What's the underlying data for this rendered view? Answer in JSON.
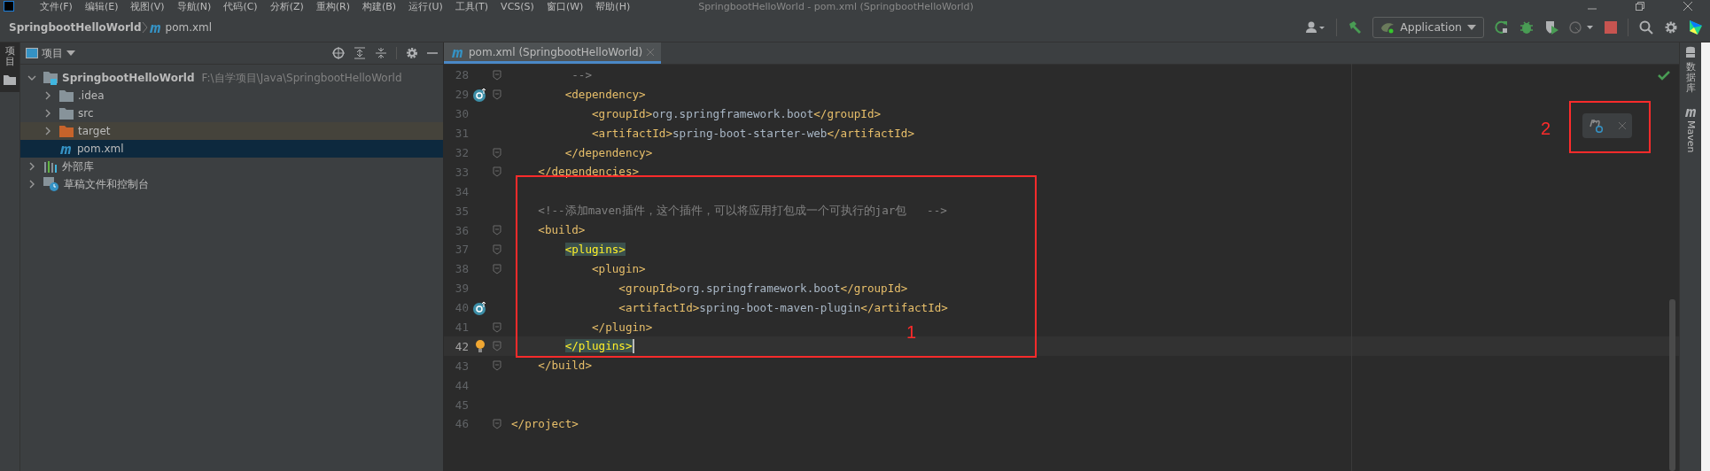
{
  "menu_bar": {
    "items": [
      "文件(F)",
      "编辑(E)",
      "视图(V)",
      "导航(N)",
      "代码(C)",
      "分析(Z)",
      "重构(R)",
      "构建(B)",
      "运行(U)",
      "工具(T)",
      "VCS(S)",
      "窗口(W)",
      "帮助(H)"
    ],
    "window_title": "SpringbootHelloWorld - pom.xml (SpringbootHelloWorld)"
  },
  "breadcrumb": [
    "SpringbootHelloWorld",
    "pom.xml"
  ],
  "toolbar": {
    "run_configuration": "Application"
  },
  "left_stripe": {
    "label": "项目"
  },
  "right_stripe": [
    "数据库",
    "Maven"
  ],
  "project_panel": {
    "title": "项目",
    "tree": [
      {
        "label": "SpringbootHelloWorld",
        "path": "F:\\自学项目\\Java\\SpringbootHelloWorld",
        "kind": "module",
        "expanded": true,
        "selected": false,
        "children": [
          {
            "label": ".idea",
            "kind": "folder",
            "expanded": false,
            "selected": false
          },
          {
            "label": "src",
            "kind": "folder",
            "expanded": false,
            "selected": false
          },
          {
            "label": "target",
            "kind": "excluded",
            "expanded": false,
            "selected": false
          },
          {
            "label": "pom.xml",
            "kind": "maven",
            "selected": true
          }
        ]
      },
      {
        "label": "外部库",
        "kind": "libraries",
        "expanded": false,
        "selected": false
      },
      {
        "label": "草稿文件和控制台",
        "kind": "scratches",
        "expanded": false,
        "selected": false
      }
    ]
  },
  "editor": {
    "tabs": [
      {
        "label": "pom.xml (SpringbootHelloWorld)",
        "selected": true
      }
    ],
    "lines": [
      {
        "number": "28",
        "text": "         -->",
        "kind": "comment",
        "fold": true,
        "override_marker": false,
        "bulb": false,
        "current": false,
        "match_highlight": false
      },
      {
        "number": "29",
        "text": "        <dependency>",
        "kind": "code",
        "fold": true,
        "override_marker": true,
        "bulb": false,
        "current": false,
        "match_highlight": false
      },
      {
        "number": "30",
        "text": "            <groupId>org.springframework.boot</groupId>",
        "kind": "code",
        "fold": false,
        "override_marker": false,
        "bulb": false,
        "current": false,
        "match_highlight": false
      },
      {
        "number": "31",
        "text": "            <artifactId>spring-boot-starter-web</artifactId>",
        "kind": "code",
        "fold": false,
        "override_marker": false,
        "bulb": false,
        "current": false,
        "match_highlight": false
      },
      {
        "number": "32",
        "text": "        </dependency>",
        "kind": "code",
        "fold": true,
        "override_marker": false,
        "bulb": false,
        "current": false,
        "match_highlight": false
      },
      {
        "number": "33",
        "text": "    </dependencies>",
        "kind": "code",
        "fold": true,
        "override_marker": false,
        "bulb": false,
        "current": false,
        "match_highlight": false
      },
      {
        "number": "34",
        "fold": false,
        "override_marker": false,
        "bulb": false,
        "current": false
      },
      {
        "number": "35",
        "text": "    <!--添加maven插件，这个插件，可以将应用打包成一个可执行的jar包   -->",
        "kind": "comment",
        "fold": false,
        "override_marker": false,
        "bulb": false,
        "current": false,
        "match_highlight": false
      },
      {
        "number": "36",
        "text": "    <build>",
        "kind": "code",
        "fold": true,
        "override_marker": false,
        "bulb": false,
        "current": false,
        "match_highlight": false
      },
      {
        "number": "37",
        "text": "        <plugins>",
        "kind": "code",
        "fold": true,
        "override_marker": false,
        "bulb": false,
        "current": false,
        "match_highlight": true
      },
      {
        "number": "38",
        "text": "            <plugin>",
        "kind": "code",
        "fold": true,
        "override_marker": false,
        "bulb": false,
        "current": false,
        "match_highlight": false
      },
      {
        "number": "39",
        "text": "                <groupId>org.springframework.boot</groupId>",
        "kind": "code",
        "fold": false,
        "override_marker": false,
        "bulb": false,
        "current": false,
        "match_highlight": false
      },
      {
        "number": "40",
        "text": "                <artifactId>spring-boot-maven-plugin</artifactId>",
        "kind": "code",
        "fold": false,
        "override_marker": true,
        "bulb": false,
        "current": false,
        "match_highlight": false
      },
      {
        "number": "41",
        "text": "            </plugin>",
        "kind": "code",
        "fold": true,
        "override_marker": false,
        "bulb": false,
        "current": false,
        "match_highlight": false
      },
      {
        "number": "42",
        "text": "        </plugins>",
        "kind": "code",
        "fold": true,
        "override_marker": false,
        "bulb": true,
        "current": true,
        "match_highlight": true
      },
      {
        "number": "43",
        "text": "    </build>",
        "kind": "code",
        "fold": true,
        "override_marker": false,
        "bulb": false,
        "current": false,
        "match_highlight": false
      },
      {
        "number": "44",
        "fold": false,
        "override_marker": false,
        "bulb": false,
        "current": false
      },
      {
        "number": "45",
        "fold": false,
        "override_marker": false,
        "bulb": false,
        "current": false
      },
      {
        "number": "46",
        "text": "</project>",
        "kind": "code",
        "fold": true,
        "override_marker": false,
        "bulb": false,
        "current": false,
        "match_highlight": false
      }
    ]
  },
  "annotations": [
    {
      "label": "1"
    },
    {
      "label": "2"
    }
  ]
}
